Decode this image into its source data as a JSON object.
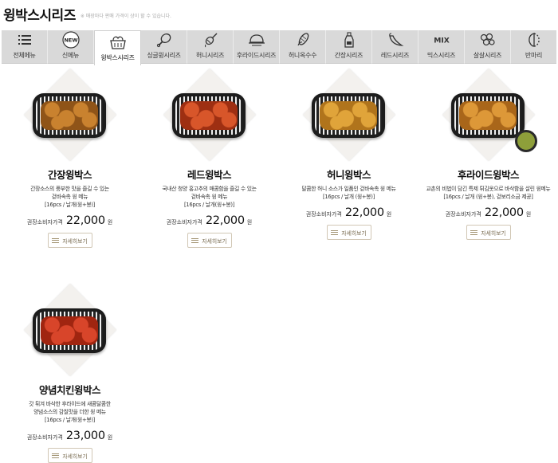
{
  "page": {
    "title": "윙박스시리즈",
    "note": "※ 매장마다 판매 가격이 상이 할 수 있습니다."
  },
  "tabs": [
    {
      "label": "전체메뉴",
      "icon": "list-icon",
      "active": false
    },
    {
      "label": "신메뉴",
      "icon": "new-badge-icon",
      "badge": "NEW",
      "active": false
    },
    {
      "label": "윙박스시리즈",
      "icon": "wing-box-icon",
      "active": true
    },
    {
      "label": "싱글윙시리즈",
      "icon": "drumstick-icon",
      "active": false
    },
    {
      "label": "허니시리즈",
      "icon": "honey-dipper-icon",
      "active": false
    },
    {
      "label": "후라이드시리즈",
      "icon": "fried-chicken-icon",
      "active": false
    },
    {
      "label": "허니옥수수",
      "icon": "corn-icon",
      "active": false
    },
    {
      "label": "간장시리즈",
      "icon": "soy-sauce-bottle-icon",
      "active": false
    },
    {
      "label": "레드시리즈",
      "icon": "red-pepper-icon",
      "active": false
    },
    {
      "label": "믹스시리즈",
      "icon": "mix-text-icon",
      "badge": "MIX",
      "active": false
    },
    {
      "label": "살살시리즈",
      "icon": "boneless-chicken-icon",
      "active": false
    },
    {
      "label": "반마리",
      "icon": "half-chicken-icon",
      "active": false
    }
  ],
  "products": [
    {
      "name": "간장윙박스",
      "desc1": "간장소스의 풍부한 맛을 즐길 수 있는",
      "desc2": "겉바속촉 윙 메뉴",
      "desc3": "[16pcs / 날개(윙+봉)]",
      "price_label": "권장소비자가격",
      "price": "22,000",
      "unit": "원",
      "detail": "자세히보기",
      "food_color": "#c9822f",
      "food_dark": "#8f5418"
    },
    {
      "name": "레드윙박스",
      "desc1": "국내산 청양 홍고추의 매콤함을 즐길 수 있는",
      "desc2": "겉바속촉 윙 메뉴",
      "desc3": "[16pcs / 날개(윙+봉)]",
      "price_label": "권장소비자가격",
      "price": "22,000",
      "unit": "원",
      "detail": "자세히보기",
      "food_color": "#d8562a",
      "food_dark": "#9e2f12"
    },
    {
      "name": "허니윙박스",
      "desc1": "달콤한 허니 소스가 일품인 겉바속촉 윙 메뉴",
      "desc2": "[16pcs / 날개 (윙+봉)]",
      "desc3": "",
      "price_label": "권장소비자가격",
      "price": "22,000",
      "unit": "원",
      "detail": "자세히보기",
      "food_color": "#e0a43a",
      "food_dark": "#b0741c"
    },
    {
      "name": "후라이드윙박스",
      "desc1": "교촌의 비법이 담긴 특제 튀김옷으로 바삭함을 살린 윙메뉴",
      "desc2": "[16pcs / 날개 (윙+봉), 겉보리소금 제공]",
      "desc3": "",
      "price_label": "권장소비자가격",
      "price": "22,000",
      "unit": "원",
      "detail": "자세히보기",
      "food_color": "#dd9838",
      "food_dark": "#a9661a"
    },
    {
      "name": "양념치킨윙박스",
      "desc1": "갓 튀겨 바삭한 후라이드에 새콤달콤한",
      "desc2": "양념소스의 감칠맛을 더한 윙 메뉴",
      "desc3": "[16pcs / 날개(윙+봉)]",
      "price_label": "권장소비자가격",
      "price": "23,000",
      "unit": "원",
      "detail": "자세히보기",
      "food_color": "#d8452a",
      "food_dark": "#a02510"
    }
  ]
}
